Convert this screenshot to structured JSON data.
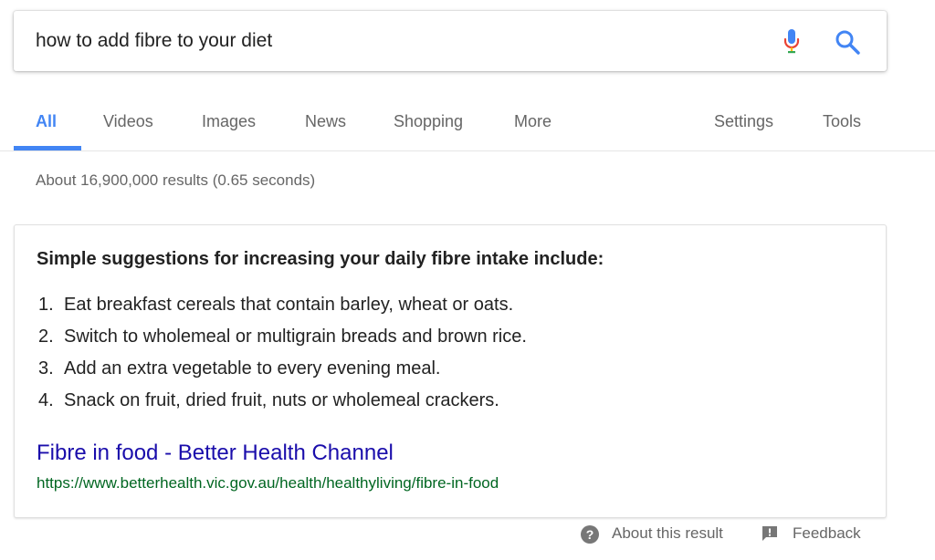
{
  "search": {
    "query": "how to add fibre to your diet",
    "mic_icon": "microphone-icon",
    "search_icon": "search-icon"
  },
  "tabs": [
    {
      "label": "All",
      "active": true
    },
    {
      "label": "Videos"
    },
    {
      "label": "Images"
    },
    {
      "label": "News"
    },
    {
      "label": "Shopping"
    },
    {
      "label": "More"
    },
    {
      "label": "Settings"
    },
    {
      "label": "Tools"
    }
  ],
  "result_stats": "About 16,900,000 results (0.65 seconds)",
  "snippet": {
    "heading": "Simple suggestions for increasing your daily fibre intake include:",
    "items": [
      {
        "num": "1.",
        "text": "Eat breakfast cereals that contain barley, wheat or oats."
      },
      {
        "num": "2.",
        "text": "Switch to wholemeal or multigrain breads and brown rice."
      },
      {
        "num": "3.",
        "text": "Add an extra vegetable to every evening meal."
      },
      {
        "num": "4.",
        "text": "Snack on fruit, dried fruit, nuts or wholemeal crackers."
      }
    ],
    "source_title": "Fibre in food - Better Health Channel",
    "source_url": "https://www.betterhealth.vic.gov.au/health/healthyliving/fibre-in-food"
  },
  "footer": {
    "about_label": "About this result",
    "about_icon": "help-circle-icon",
    "help_glyph": "?",
    "feedback_label": "Feedback",
    "feedback_icon": "feedback-icon"
  },
  "colors": {
    "accent": "#4285f4",
    "link": "#1a0dab",
    "url": "#006621",
    "muted": "#666666"
  }
}
